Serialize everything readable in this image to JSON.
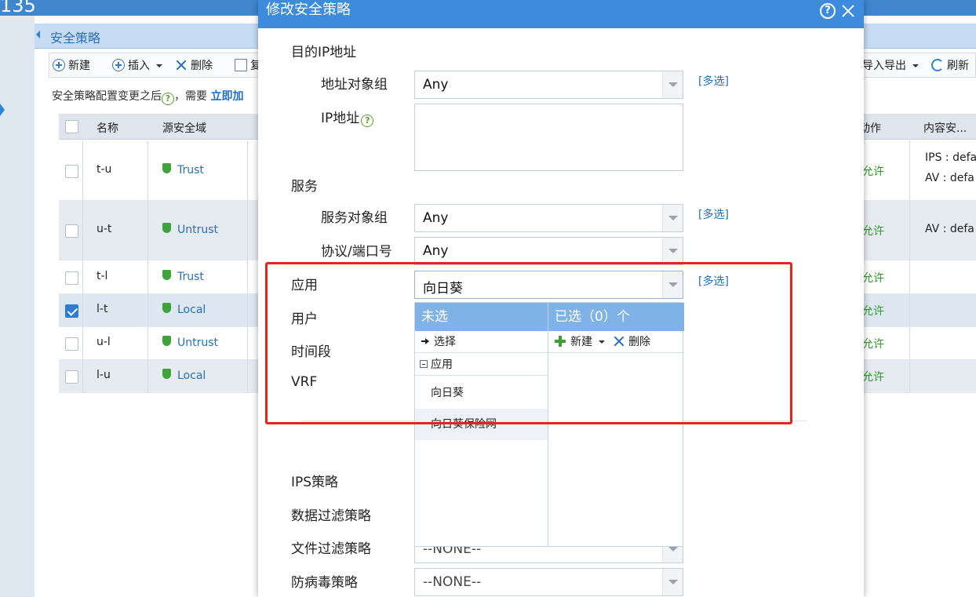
{
  "window": {
    "top_number": "135"
  },
  "panel": {
    "title": "安全策略"
  },
  "toolbar": {
    "new": "新建",
    "insert": "插入",
    "delete": "删除",
    "copy": "复",
    "import_export": "导入导出",
    "refresh": "刷新"
  },
  "notice": {
    "text": "安全策略配置变更之后",
    "text2": "，需要 ",
    "link": "立即加"
  },
  "grid": {
    "headers": {
      "name": "名称",
      "src_zone": "源安全域",
      "action": "动作",
      "content": "内容安..."
    },
    "rows": [
      {
        "name": "t-u",
        "zone": "Trust",
        "action": "允许",
        "content1": "IPS : defa",
        "content2": "AV : defa",
        "checked": false
      },
      {
        "name": "u-t",
        "zone": "Untrust",
        "action": "允许",
        "content1": "AV : defa",
        "content2": "",
        "checked": false
      },
      {
        "name": "t-l",
        "zone": "Trust",
        "action": "允许",
        "content1": "",
        "content2": "",
        "checked": false
      },
      {
        "name": "l-t",
        "zone": "Local",
        "action": "允许",
        "content1": "",
        "content2": "",
        "checked": true
      },
      {
        "name": "u-l",
        "zone": "Untrust",
        "action": "允许",
        "content1": "",
        "content2": "",
        "checked": false
      },
      {
        "name": "l-u",
        "zone": "Local",
        "action": "允许",
        "content1": "",
        "content2": "",
        "checked": false
      }
    ]
  },
  "dialog": {
    "title": "修改安全策略",
    "dest_ip_label": "目的IP地址",
    "addr_group_label": "地址对象组",
    "addr_group_value": "Any",
    "ip_label": "IP地址",
    "multi": "[多选]",
    "service_label": "服务",
    "service_group_label": "服务对象组",
    "service_group_value": "Any",
    "proto_port_label": "协议/端口号",
    "proto_port_value": "Any",
    "app_label": "应用",
    "app_value": "向日葵",
    "user_label": "用户",
    "time_label": "时间段",
    "vrf_label": "VRF",
    "ips_label": "IPS策略",
    "data_filter_label": "数据过滤策略",
    "file_filter_label": "文件过滤策略",
    "file_filter_value": "--NONE--",
    "av_label": "防病毒策略",
    "av_value": "--NONE--"
  },
  "picker": {
    "unselected_header": "未选",
    "selected_header": "已选（0）个",
    "select_btn": "选择",
    "new_btn": "新建",
    "delete_btn": "删除",
    "tree_root": "应用",
    "options": [
      "向日葵",
      "向日葵保险网"
    ]
  },
  "colors": {
    "dialog_header": "#3d8bdc",
    "picker_header": "#7fb2e6",
    "highlight_box": "#e6231c",
    "allow_text": "#2e9a2a"
  }
}
